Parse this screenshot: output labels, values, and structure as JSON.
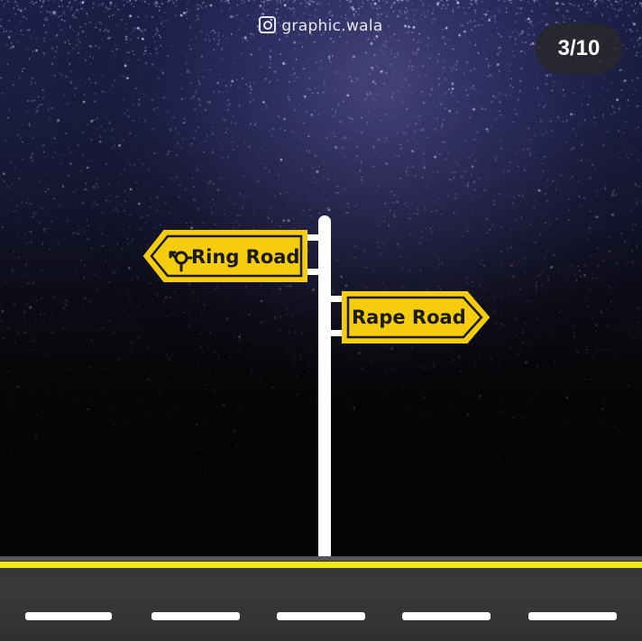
{
  "post": {
    "handle": "graphic.wala",
    "counter": "3/10"
  },
  "signs": {
    "left": {
      "label": "Ring Road",
      "icon": "roundabout-icon",
      "direction": "left"
    },
    "right": {
      "label": "Rape Road",
      "direction": "right"
    }
  },
  "colors": {
    "sign_yellow": "#f5cc0e",
    "sign_border": "#1a1a1a",
    "road_line_yellow": "#f2e91a",
    "sky_top": "#1d1f47"
  }
}
